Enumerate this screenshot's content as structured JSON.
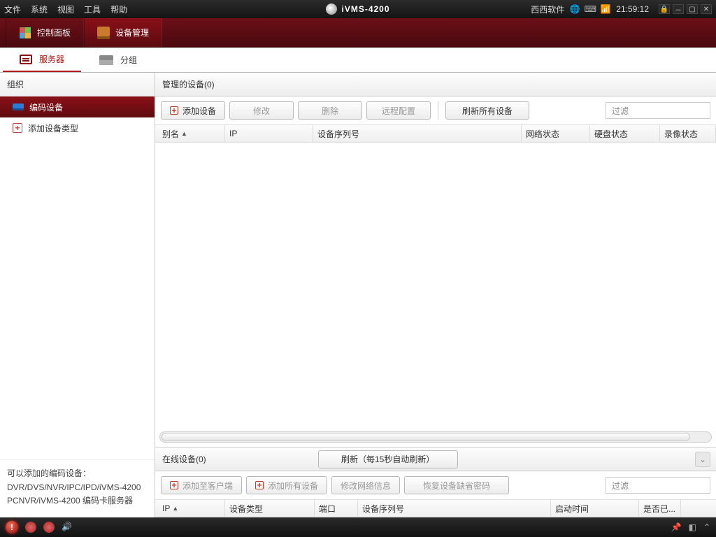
{
  "menu": {
    "file": "文件",
    "system": "系统",
    "view": "视图",
    "tools": "工具",
    "help": "帮助"
  },
  "app_title": "iVMS-4200",
  "vendor": "西西软件",
  "clock": "21:59:12",
  "tabs": {
    "control_panel": "控制面板",
    "device_mgmt": "设备管理"
  },
  "subtabs": {
    "server": "服务器",
    "group": "分组"
  },
  "sidebar": {
    "header": "组织",
    "items": [
      "编码设备",
      "添加设备类型"
    ],
    "footer_title": "可以添加的编码设备：",
    "footer_line1": "DVR/DVS/NVR/IPC/IPD/iVMS-4200",
    "footer_line2": "PCNVR/iVMS-4200 编码卡服务器"
  },
  "managed": {
    "header": "管理的设备(0)",
    "btn_add": "添加设备",
    "btn_edit": "修改",
    "btn_delete": "删除",
    "btn_remote": "远程配置",
    "btn_refresh_all": "刷新所有设备",
    "filter_placeholder": "过滤",
    "cols": {
      "alias": "别名",
      "ip": "IP",
      "serial": "设备序列号",
      "net": "网络状态",
      "hdd": "硬盘状态",
      "rec": "录像状态"
    }
  },
  "online": {
    "header": "在线设备(0)",
    "btn_refresh": "刷新（每15秒自动刷新）",
    "btn_to_client": "添加至客户端",
    "btn_add_all": "添加所有设备",
    "btn_netinfo": "修改网络信息",
    "btn_restore_pwd": "恢复设备缺省密码",
    "filter_placeholder": "过滤",
    "cols": {
      "ip": "IP",
      "type": "设备类型",
      "port": "端口",
      "serial": "设备序列号",
      "start": "启动时间",
      "added": "是否已..."
    }
  }
}
